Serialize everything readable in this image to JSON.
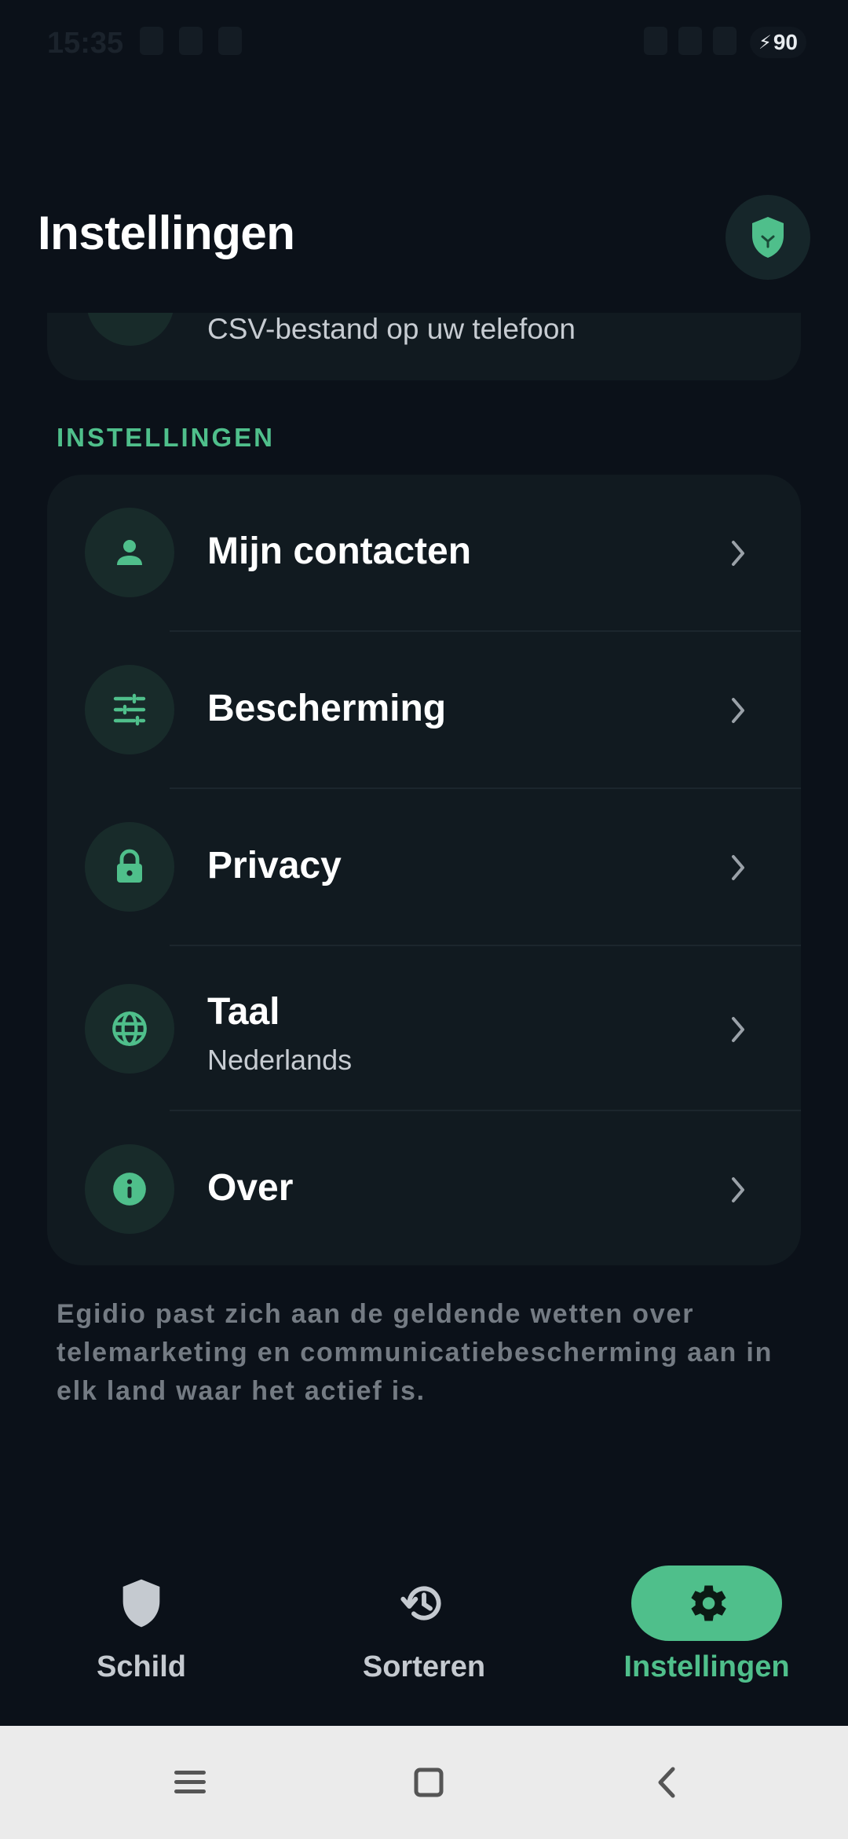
{
  "status_bar": {
    "time": "15:35",
    "battery": "90"
  },
  "header": {
    "title": "Instellingen",
    "badge_icon": "shield-icon"
  },
  "previous_card": {
    "subtitle": "CSV-bestand op uw telefoon"
  },
  "section": {
    "label": "INSTELLINGEN"
  },
  "settings": {
    "items": [
      {
        "label": "Mijn contacten",
        "icon": "person-icon"
      },
      {
        "label": "Bescherming",
        "icon": "tune-icon"
      },
      {
        "label": "Privacy",
        "icon": "lock-icon"
      },
      {
        "label": "Taal",
        "sublabel": "Nederlands",
        "icon": "globe-icon"
      },
      {
        "label": "Over",
        "icon": "info-icon"
      }
    ]
  },
  "footnote": "Egidio past zich aan de geldende wetten over telemarketing en communicatiebescherming aan in elk land waar het actief is.",
  "bottom_nav": {
    "items": [
      {
        "label": "Schild",
        "icon": "shield-icon",
        "active": false
      },
      {
        "label": "Sorteren",
        "icon": "history-icon",
        "active": false
      },
      {
        "label": "Instellingen",
        "icon": "gear-icon",
        "active": true
      }
    ]
  },
  "colors": {
    "accent": "#4fbf8b",
    "background": "#0b1119",
    "card": "#111a20"
  }
}
